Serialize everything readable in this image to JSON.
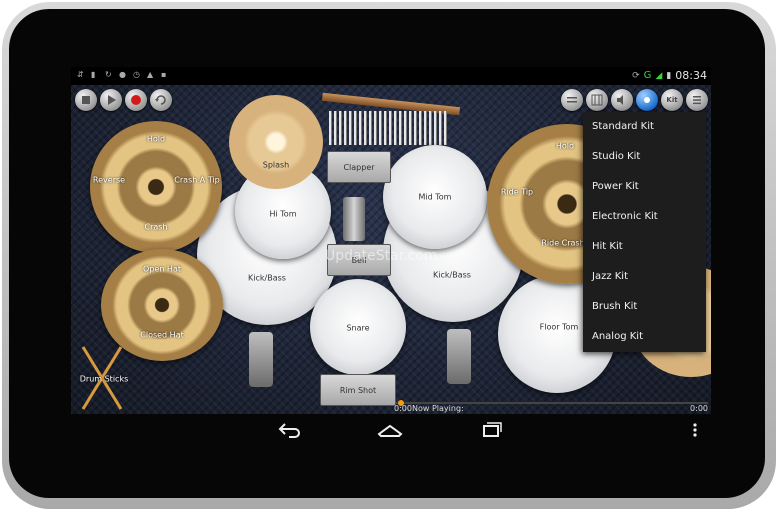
{
  "status_bar": {
    "time": "08:34",
    "signal": "G"
  },
  "toolbar_left": [
    {
      "name": "stop-button",
      "icon": "stop-icon"
    },
    {
      "name": "play-button",
      "icon": "play-icon"
    },
    {
      "name": "record-button",
      "icon": "record-icon",
      "color": "#d21a1a"
    },
    {
      "name": "loop-button",
      "icon": "loop-icon"
    }
  ],
  "toolbar_right": {
    "kit_label": "Kit",
    "icons": [
      "mixer-icon",
      "grid-icon",
      "volume-icon",
      "tap-icon",
      "kit-icon",
      "menu-icon"
    ]
  },
  "kit_menu": {
    "items": [
      "Standard Kit",
      "Studio Kit",
      "Power Kit",
      "Electronic Kit",
      "Hit Kit",
      "Jazz Kit",
      "Brush Kit",
      "Analog Kit"
    ]
  },
  "drums": {
    "splash": "Splash",
    "clapper": "Clapper",
    "hi_tom": "Hi Tom",
    "mid_tom": "Mid Tom",
    "kick_left": "Kick/Bass",
    "kick_right": "Kick/Bass",
    "bell": "Bell",
    "snare": "Snare",
    "floor_tom": "Floor Tom",
    "rim_shot": "Rim Shot"
  },
  "cymbals": {
    "crash_left": {
      "top": "Hold",
      "left": "Reverse",
      "right": "Crash A Tip",
      "bottom": "Crash"
    },
    "hi_hat": {
      "top": "Open Hat",
      "bottom": "Closed Hat"
    },
    "ride": {
      "top": "Hold",
      "left": "Ride Tip",
      "bottom": "Ride Crash"
    }
  },
  "drum_sticks": "Drum Sticks",
  "playback": {
    "elapsed": "0:00",
    "now_playing": "Now Playing:",
    "remaining": "0:00",
    "progress": 0.0
  },
  "watermark": "UpdateStar.com",
  "nav": {
    "back": "back-icon",
    "home": "home-icon",
    "recents": "recents-icon",
    "overflow": "overflow-icon"
  }
}
